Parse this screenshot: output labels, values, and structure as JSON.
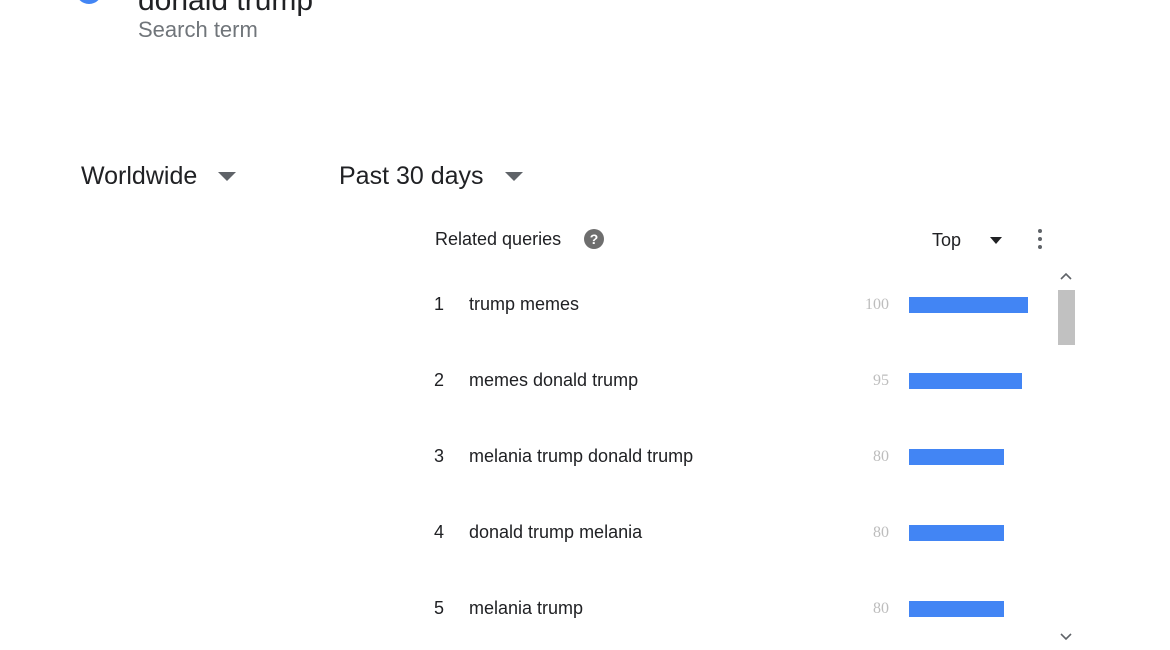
{
  "search_term": {
    "title": "donald trump",
    "subtitle": "Search term",
    "dot_color": "#4285f4"
  },
  "filters": {
    "geo": "Worldwide",
    "time": "Past 30 days"
  },
  "related_queries": {
    "title": "Related queries",
    "help_icon": "?",
    "sort_option": "Top",
    "bar_color": "#4285f4",
    "rows": [
      {
        "rank": "1",
        "query": "trump memes",
        "value": 100
      },
      {
        "rank": "2",
        "query": "memes donald trump",
        "value": 95
      },
      {
        "rank": "3",
        "query": "melania trump donald trump",
        "value": 80
      },
      {
        "rank": "4",
        "query": "donald trump melania",
        "value": 80
      },
      {
        "rank": "5",
        "query": "melania trump",
        "value": 80
      }
    ]
  },
  "icons": {
    "help": "help-circle-icon",
    "more": "more-vert-icon",
    "scroll_up": "chevron-up-icon",
    "scroll_down": "chevron-down-icon",
    "dropdown": "arrow-drop-down-icon"
  }
}
